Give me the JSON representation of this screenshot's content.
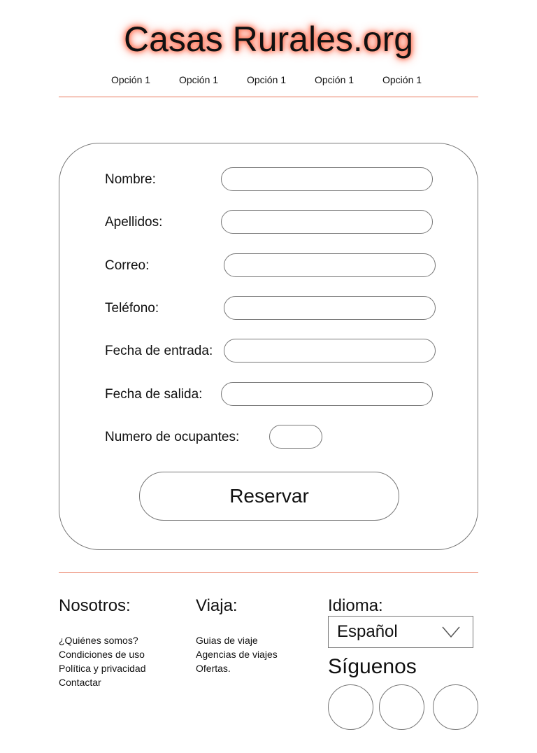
{
  "header": {
    "title": "Casas Rurales.org",
    "glow_color": "#ff6a4a"
  },
  "nav": {
    "items": [
      {
        "label": "Opción 1"
      },
      {
        "label": "Opción 1"
      },
      {
        "label": "Opción 1"
      },
      {
        "label": "Opción 1"
      },
      {
        "label": "Opción 1"
      }
    ]
  },
  "divider_color": "#e8765a",
  "form": {
    "nombre_label": "Nombre:",
    "apellidos_label": "Apellidos:",
    "correo_label": "Correo:",
    "telefono_label": "Teléfono:",
    "fecha_entrada_label": "Fecha de entrada:",
    "fecha_salida_label": "Fecha de salida:",
    "ocupantes_label": "Numero de ocupantes:",
    "submit_label": "Reservar"
  },
  "footer": {
    "nosotros": {
      "heading": "Nosotros:",
      "links": [
        "¿Quiénes somos?",
        "Condiciones de uso",
        "Política y privacidad",
        "Contactar"
      ]
    },
    "viaja": {
      "heading": "Viaja:",
      "links": [
        "Guias de viaje",
        "Agencias de viajes",
        "Ofertas."
      ]
    },
    "idioma": {
      "heading": "Idioma:",
      "selected": "Español"
    },
    "siguenos": {
      "heading": "Síguenos"
    }
  }
}
